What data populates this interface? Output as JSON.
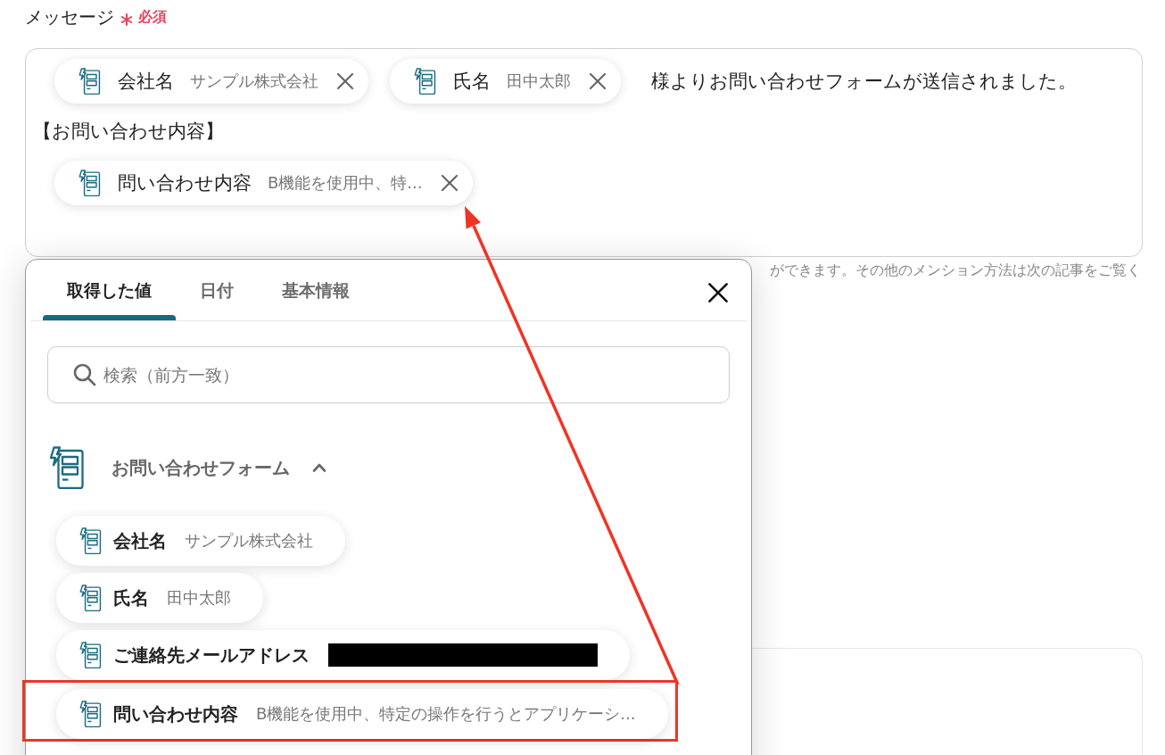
{
  "field": {
    "label": "メッセージ",
    "required": true,
    "required_label": "必須"
  },
  "message": {
    "lines": [
      [
        {
          "kind": "chip",
          "label": "会社名",
          "value": "サンプル株式会社"
        },
        {
          "kind": "chip",
          "label": "氏名",
          "value": "田中太郎"
        },
        {
          "kind": "text",
          "text": "様よりお問い合わせフォームが送信されました。"
        }
      ],
      [
        {
          "kind": "text",
          "text": "【お問い合わせ内容】"
        }
      ],
      [
        {
          "kind": "chip",
          "label": "問い合わせ内容",
          "value": "B機能を使用中、特..."
        }
      ]
    ]
  },
  "hint": "ができます。その他のメンション方法は次の記事をご覧く",
  "picker": {
    "tabs": [
      {
        "label": "取得した値",
        "selected": true
      },
      {
        "label": "日付",
        "selected": false
      },
      {
        "label": "基本情報",
        "selected": false
      }
    ],
    "search": {
      "placeholder": "検索（前方一致）"
    },
    "section": {
      "title": "お問い合わせフォーム",
      "expanded": true,
      "items": [
        {
          "label": "会社名",
          "value": "サンプル株式会社",
          "redacted": false,
          "highlighted": false
        },
        {
          "label": "氏名",
          "value": "田中太郎",
          "redacted": false,
          "highlighted": false
        },
        {
          "label": "ご連絡先メールアドレス",
          "redacted": true,
          "highlighted": false
        },
        {
          "label": "問い合わせ内容",
          "value": "B機能を使用中、特定の操作を行うとアプリケーシ...",
          "redacted": false,
          "highlighted": true
        }
      ]
    }
  }
}
